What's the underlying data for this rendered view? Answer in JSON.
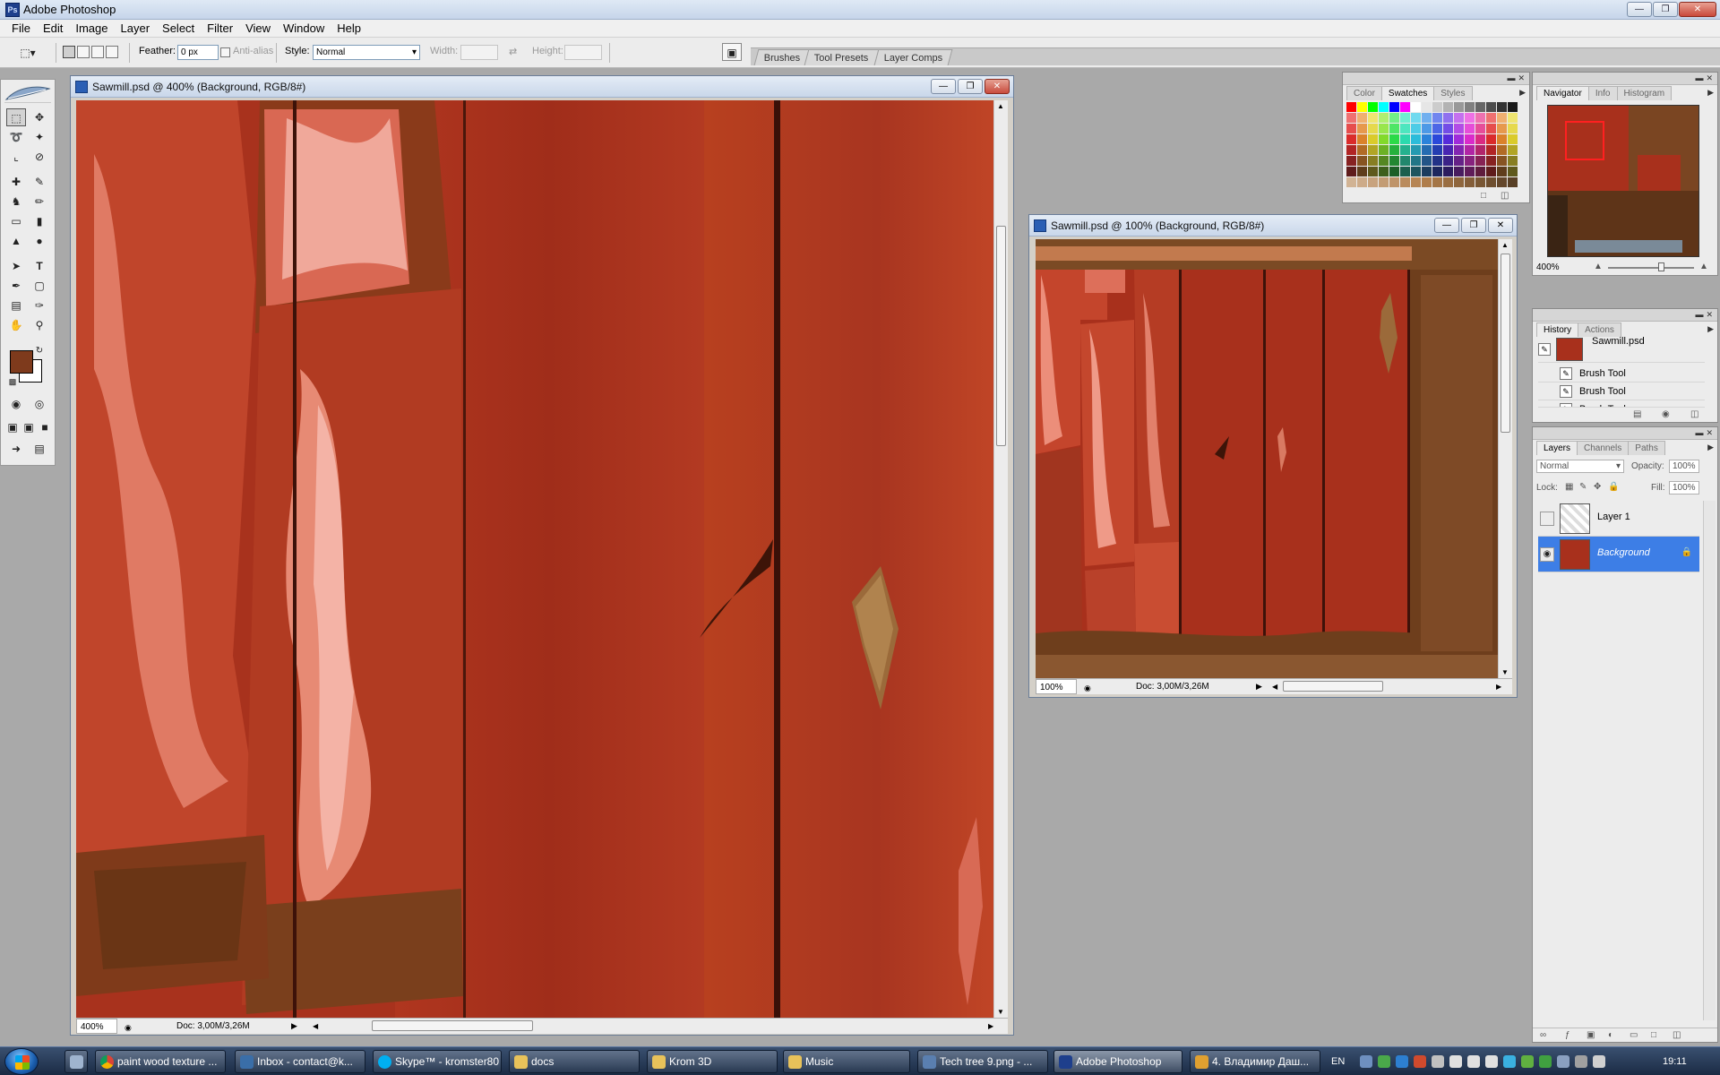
{
  "app": {
    "title": "Adobe Photoshop"
  },
  "menu": [
    "File",
    "Edit",
    "Image",
    "Layer",
    "Select",
    "Filter",
    "View",
    "Window",
    "Help"
  ],
  "options": {
    "feather_label": "Feather:",
    "feather_value": "0 px",
    "antialias_label": "Anti-alias",
    "style_label": "Style:",
    "style_value": "Normal",
    "width_label": "Width:",
    "height_label": "Height:",
    "well_tabs": [
      "Brushes",
      "Tool Presets",
      "Layer Comps"
    ]
  },
  "doc_main": {
    "title": "Sawmill.psd @ 400% (Background, RGB/8#)",
    "zoom": "400%",
    "doc_info": "Doc: 3,00M/3,26M"
  },
  "doc_small": {
    "title": "Sawmill.psd @ 100% (Background, RGB/8#)",
    "zoom": "100%",
    "doc_info": "Doc: 3,00M/3,26M"
  },
  "palette_color": {
    "tabs": [
      "Color",
      "Swatches",
      "Styles"
    ],
    "active": "Swatches"
  },
  "palette_navigator": {
    "tabs": [
      "Navigator",
      "Info",
      "Histogram"
    ],
    "zoom": "400%"
  },
  "palette_history": {
    "tabs": [
      "History",
      "Actions"
    ],
    "snapshot": "Sawmill.psd",
    "items": [
      "Brush Tool",
      "Brush Tool",
      "Brush Tool"
    ]
  },
  "palette_layers": {
    "tabs": [
      "Layers",
      "Channels",
      "Paths"
    ],
    "blend_mode": "Normal",
    "opacity_label": "Opacity:",
    "opacity_value": "100%",
    "lock_label": "Lock:",
    "fill_label": "Fill:",
    "fill_value": "100%",
    "layers": [
      "Layer 1",
      "Background"
    ]
  },
  "taskbar": {
    "tasks": [
      "paint wood texture ...",
      "Inbox - contact@k...",
      "Skype™ - kromster80",
      "docs",
      "Krom 3D",
      "Music",
      "Tech tree 9.png - ...",
      "Adobe Photoshop",
      "4. Владимир Даш..."
    ],
    "language": "EN",
    "clock": "19:11"
  },
  "colors": {
    "foreground": "#7e3a1c",
    "background": "#ffffff",
    "selection": "#3d7ee6",
    "wood_red": "#a3301c"
  }
}
